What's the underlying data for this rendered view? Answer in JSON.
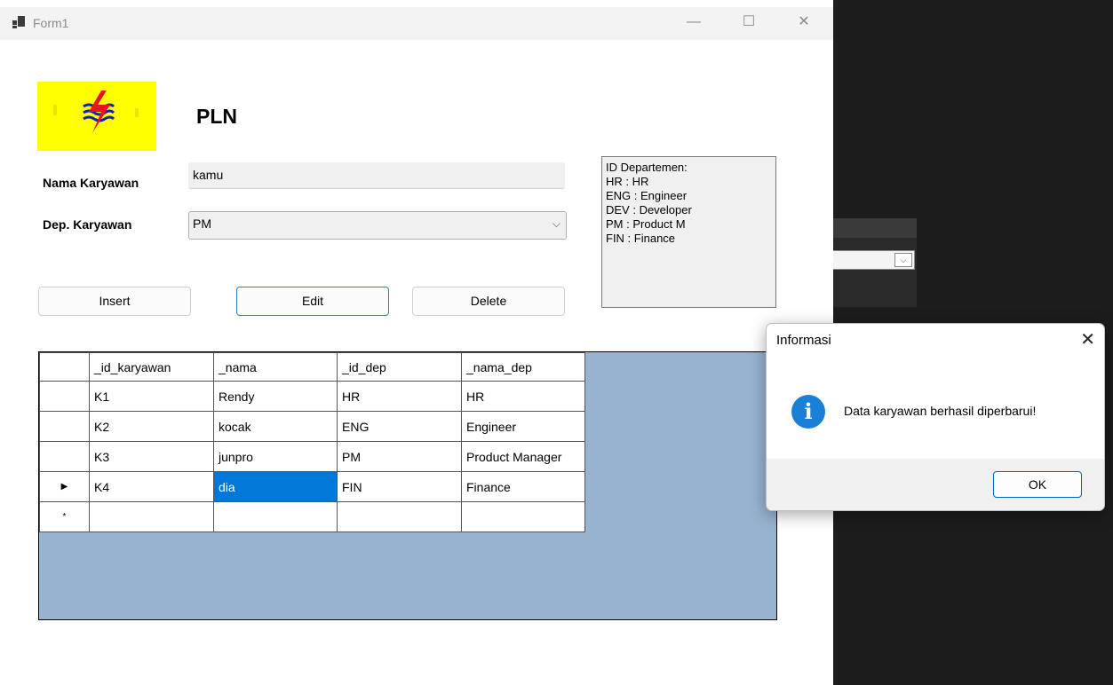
{
  "window": {
    "title": "Form1"
  },
  "header": {
    "title": "PLN"
  },
  "form": {
    "nama_label": "Nama Karyawan",
    "nama_value": "kamu",
    "dep_label": "Dep. Karyawan",
    "dep_value": "PM"
  },
  "info": {
    "lines": [
      "ID Departemen:",
      "HR : HR",
      "ENG : Engineer",
      "DEV : Developer",
      "PM : Product M",
      "FIN : Finance"
    ]
  },
  "buttons": {
    "insert": "Insert",
    "edit": "Edit",
    "delete": "Delete"
  },
  "grid": {
    "columns": [
      "_id_karyawan",
      "_nama",
      "_id_dep",
      "_nama_dep"
    ],
    "rows": [
      [
        "K1",
        "Rendy",
        "HR",
        "HR"
      ],
      [
        "K2",
        "kocak",
        "ENG",
        "Engineer"
      ],
      [
        "K3",
        "junpro",
        "PM",
        "Product Manager"
      ],
      [
        "K4",
        "dia",
        "FIN",
        "Finance"
      ]
    ],
    "current_row_marker": "▶",
    "new_row_marker": "*"
  },
  "dialog": {
    "title": "Informasi",
    "icon": "info-icon",
    "message": "Data karyawan berhasil diperbarui!",
    "ok_label": "OK",
    "close_glyph": "✕"
  },
  "colors": {
    "accent": "#0078d7",
    "grid_background": "#97b3cf",
    "logo_background": "#ffff00"
  }
}
